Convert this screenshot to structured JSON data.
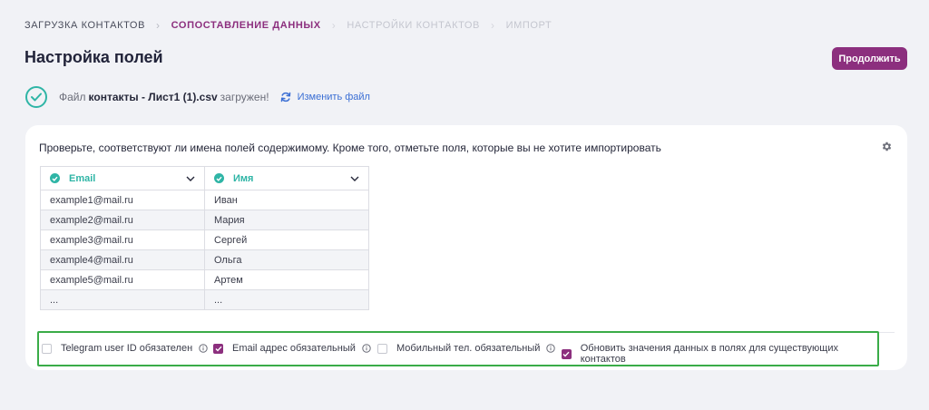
{
  "breadcrumb": {
    "step1": "Загрузка контактов",
    "step2": "Сопоставление данных",
    "step3": "Настройки контактов",
    "step4": "Импорт",
    "separator": "›"
  },
  "header": {
    "title": "Настройка полей",
    "continue_label": "Продолжить"
  },
  "file_status": {
    "prefix": "Файл",
    "file_name": "контакты - Лист1 (1).csv",
    "suffix": "загружен!",
    "change_label": "Изменить файл"
  },
  "card": {
    "hint": "Проверьте, соответствуют ли имена полей содержимому. Кроме того, отметьте поля, которые вы не хотите импортировать"
  },
  "table": {
    "columns": [
      "Email",
      "Имя"
    ],
    "rows": [
      [
        "example1@mail.ru",
        "Иван"
      ],
      [
        "example2@mail.ru",
        "Мария"
      ],
      [
        "example3@mail.ru",
        "Сергей"
      ],
      [
        "example4@mail.ru",
        "Ольга"
      ],
      [
        "example5@mail.ru",
        "Артем"
      ],
      [
        "...",
        "..."
      ]
    ]
  },
  "options": {
    "telegram_label": "Telegram user ID обязателен",
    "telegram_checked": false,
    "email_label": "Email адрес обязательный",
    "email_checked": true,
    "phone_label": "Мобильный тел. обязательный",
    "phone_checked": false,
    "update_label": "Обновить значения данных в полях для существующих контактов",
    "update_checked": true
  },
  "colors": {
    "accent": "#8c2f7e",
    "success": "#2fb5a6",
    "link": "#3b6fd4",
    "highlight_border": "#3aac48"
  }
}
